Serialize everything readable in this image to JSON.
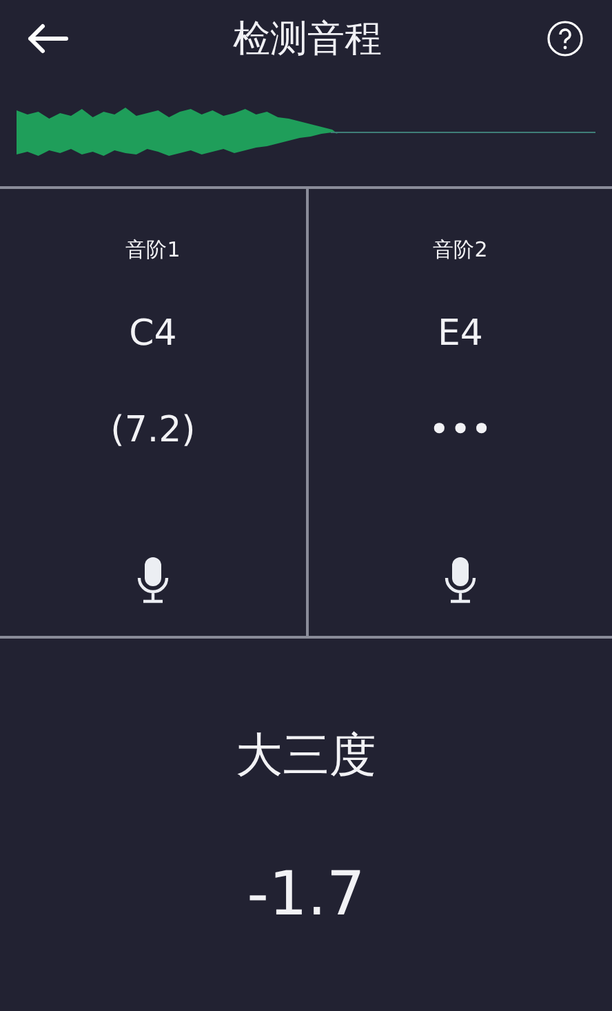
{
  "header": {
    "title": "检测音程"
  },
  "scales": [
    {
      "label": "音阶1",
      "note": "C4",
      "reading": "(7.2)"
    },
    {
      "label": "音阶2",
      "note": "E4",
      "reading": "•••"
    }
  ],
  "result": {
    "interval": "大三度",
    "deviation": "-1.7"
  }
}
